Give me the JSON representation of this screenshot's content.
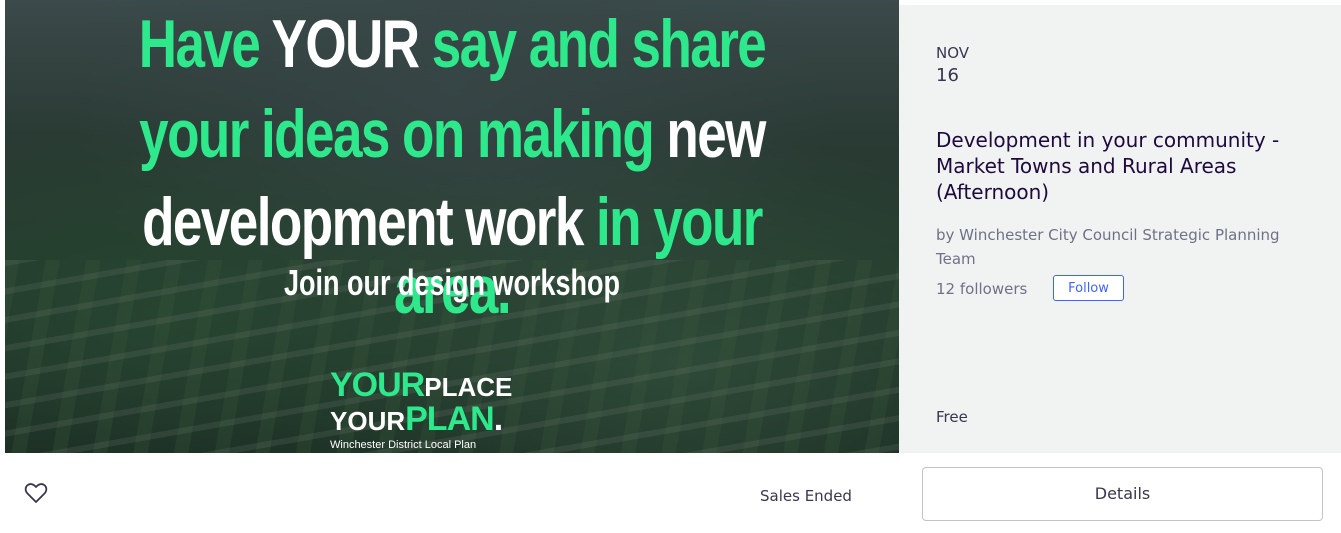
{
  "banner": {
    "line1": {
      "a": "Have ",
      "b": "YOUR",
      "c": " say and share"
    },
    "line2": {
      "a": "your ideas on making",
      "b": " new"
    },
    "line3": {
      "a": "development work",
      "b": " in your area."
    },
    "subline": "Join our design workshop",
    "logo": {
      "your1": "YOUR",
      "place": "PLACE",
      "your2": "YOUR",
      "plan": "PLAN",
      "dot": ".",
      "tagline": "Winchester District Local Plan"
    },
    "colors": {
      "green": "#2ee88c",
      "white": "#ffffff"
    }
  },
  "event": {
    "month": "NOV",
    "day": "16",
    "title": "Development in your community - Market Towns and Rural Areas (Afternoon)",
    "organizer": "by Winchester City Council Strategic Planning Team",
    "followers": "12 followers",
    "follow_label": "Follow",
    "price": "Free"
  },
  "footer": {
    "heart_icon": "heart-outline-icon",
    "sales_status": "Sales Ended",
    "details_label": "Details"
  }
}
